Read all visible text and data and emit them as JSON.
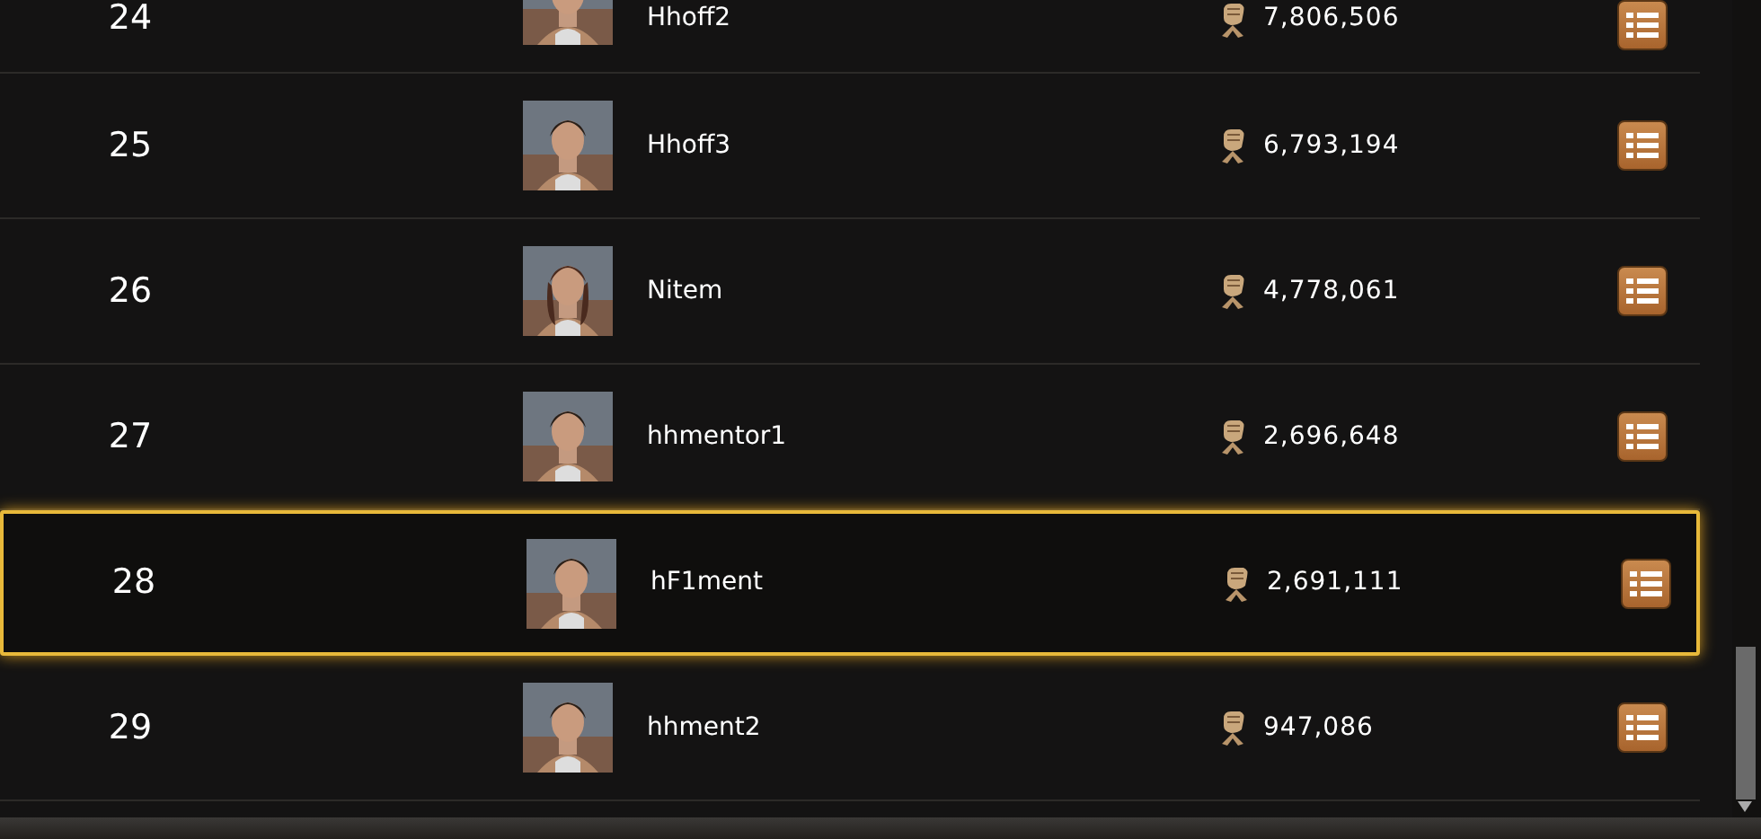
{
  "rows": [
    {
      "rank": "24",
      "name": "Hhoff2",
      "score": "7,806,506",
      "selected": false
    },
    {
      "rank": "25",
      "name": "Hhoff3",
      "score": "6,793,194",
      "selected": false
    },
    {
      "rank": "26",
      "name": "Nitem",
      "score": "4,778,061",
      "selected": false
    },
    {
      "rank": "27",
      "name": "hhmentor1",
      "score": "2,696,648",
      "selected": false
    },
    {
      "rank": "28",
      "name": "hF1ment",
      "score": "2,691,111",
      "selected": true
    },
    {
      "rank": "29",
      "name": "hhment2",
      "score": "947,086",
      "selected": false
    }
  ]
}
